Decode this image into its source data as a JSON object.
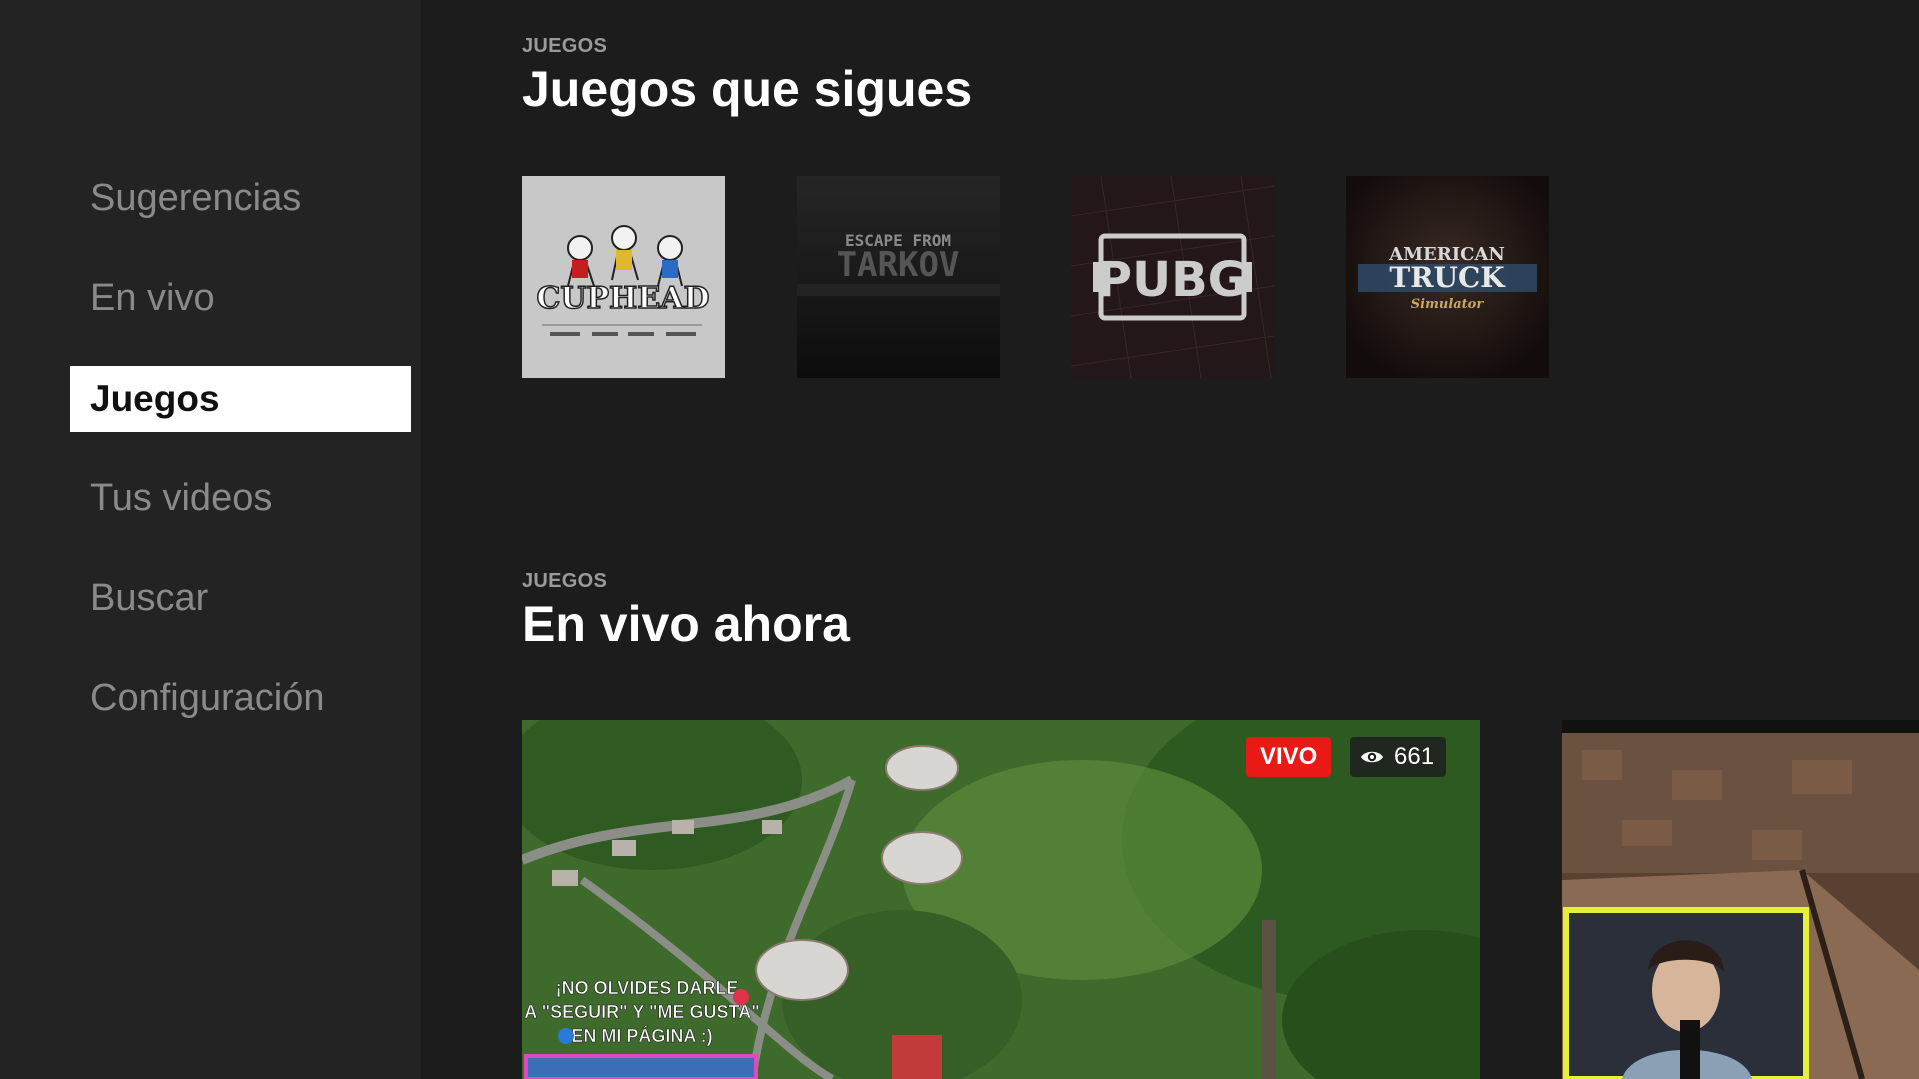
{
  "sidebar": {
    "items": [
      {
        "label": "Sugerencias",
        "active": false
      },
      {
        "label": "En vivo",
        "active": false
      },
      {
        "label": "Juegos",
        "active": true
      },
      {
        "label": "Tus videos",
        "active": false
      },
      {
        "label": "Buscar",
        "active": false
      },
      {
        "label": "Configuración",
        "active": false
      }
    ]
  },
  "followed": {
    "eyebrow": "JUEGOS",
    "title": "Juegos que sigues",
    "games": [
      {
        "name": "Cuphead",
        "art_text": "CUPHEAD"
      },
      {
        "name": "Escape from Tarkov",
        "art_text_top": "ESCAPE FROM",
        "art_text_main": "TARKOV"
      },
      {
        "name": "PUBG",
        "art_text": "PUBG"
      },
      {
        "name": "American Truck Simulator",
        "art_text_top": "AMERICAN",
        "art_text_main": "TRUCK",
        "art_text_sub": "Simulator"
      }
    ]
  },
  "live": {
    "eyebrow": "JUEGOS",
    "title": "En vivo ahora",
    "streams": [
      {
        "live_label": "VIVO",
        "viewers": "661",
        "overlay_line1": "¡NO OLVIDES DARLE",
        "overlay_line2": "A \"SEGUIR\" Y \"ME GUSTA\"",
        "overlay_line3": "EN MI PÁGINA :)"
      },
      {
        "live_label": "",
        "viewers": ""
      }
    ]
  },
  "colors": {
    "sidebar_bg": "#232323",
    "main_bg": "#1c1c1c",
    "live_red": "#e91916",
    "webcam_border": "#e4f03a"
  }
}
